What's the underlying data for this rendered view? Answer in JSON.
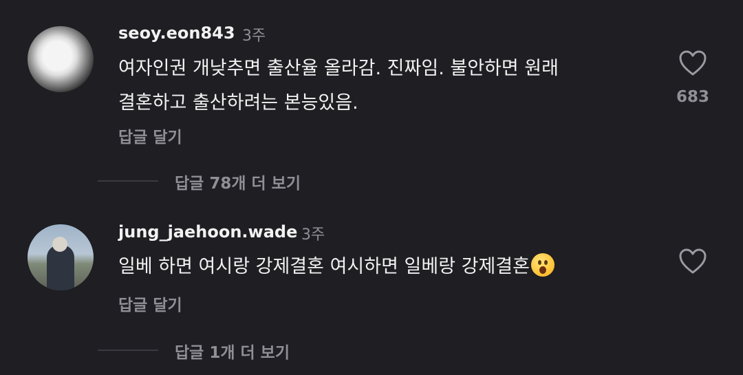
{
  "comments": [
    {
      "username": "seoy.eon843",
      "time": "3주",
      "lines": [
        "여자인권 개낮추면 출산율 올라감. 진짜임. 불안하면 원래",
        "결혼하고 출산하려는 본능있음."
      ],
      "reply_label": "답글 달기",
      "likes": "683",
      "more_replies": "답글 78개 더 보기",
      "avatar_icon": "dog-photo-avatar"
    },
    {
      "username": "jung_jaehoon.wade",
      "time": "3주",
      "text": "일베 하면 여시랑 강제결혼 여시하면 일베랑 강제결혼",
      "emoji": "astonished-face-emoji",
      "reply_label": "답글 달기",
      "more_replies": "답글 1개 더 보기",
      "avatar_icon": "person-photo-avatar"
    }
  ],
  "colors": {
    "background": "#1e1e23",
    "text": "#f2f2f2",
    "muted": "#8f8f95"
  }
}
